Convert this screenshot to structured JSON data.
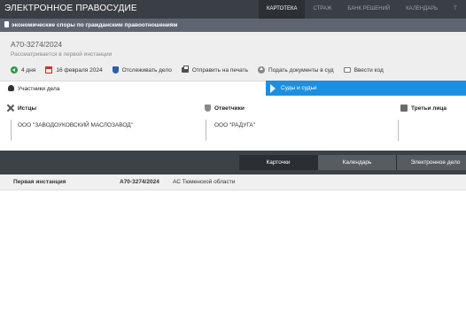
{
  "header": {
    "brand": "ЭЛЕКТРОННОЕ ПРАВОСУДИЕ",
    "nav": [
      "КАРТОТЕКА",
      "СТРАЖ",
      "БАНК РЕШЕНИЙ",
      "КАЛЕНДАРЬ",
      "Т"
    ],
    "active_nav": "КАРТОТЕКА"
  },
  "banner": {
    "text": "экономические споры по гражданским правоотношениям"
  },
  "case": {
    "number": "А70-3274/2024",
    "status": "Рассматривается в первой инстанции",
    "actions": {
      "days": "4 дня",
      "date": "16 февраля 2024",
      "track": "Отслеживать дело",
      "print": "Отправить на печать",
      "submit": "Подать документы в суд",
      "code": "Ввести код"
    }
  },
  "tabs": {
    "participants": "Участники дела",
    "courts": "Суды и судьи"
  },
  "participants": {
    "plaintiffs": {
      "header": "Истцы",
      "value": "ООО \"ЗАВОДОУКОВСКИЙ МАСЛОЗАВОД\""
    },
    "defendants": {
      "header": "Ответчики",
      "value": "ООО \"РАДУГА\""
    },
    "third_parties": {
      "header": "Третьи лица",
      "value": ""
    }
  },
  "subnav": [
    "Карточки",
    "Календарь",
    "Электронное дело"
  ],
  "instance": {
    "label": "Первая инстанция",
    "case_number": "А70-3274/2024",
    "court": "АС Тюменской области"
  },
  "colors": {
    "header_bg": "#3a3f45",
    "banner_bg": "#5e6570",
    "accent_tab": "#1d8fe1",
    "subbar_bg": "#3d4248"
  }
}
